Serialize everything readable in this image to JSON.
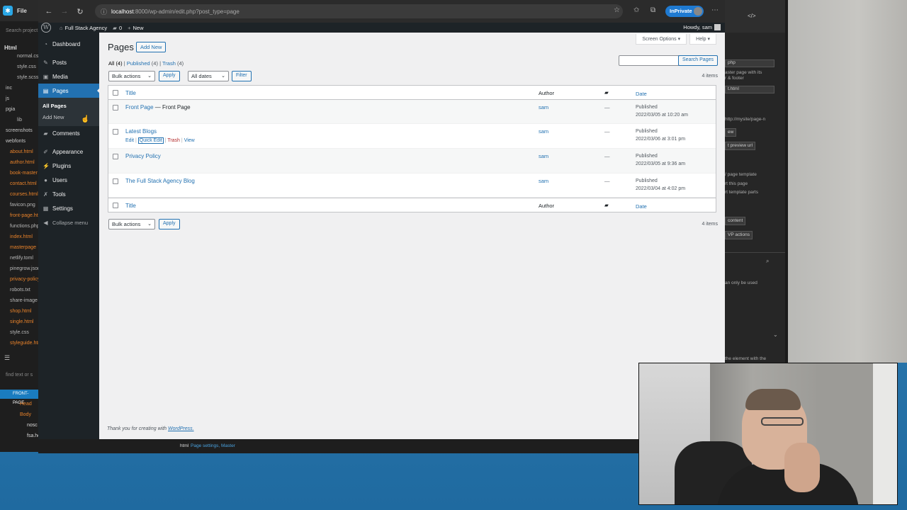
{
  "ide_left": {
    "top_label": "File",
    "search_placeholder": "Search project",
    "html_heading": "Html",
    "files": [
      {
        "name": "normal.css",
        "type": "indent-plain"
      },
      {
        "name": "style.css",
        "type": "indent-plain"
      },
      {
        "name": "style.scss",
        "type": "indent-plain"
      },
      {
        "name": "inc",
        "type": "folder"
      },
      {
        "name": "js",
        "type": "folder"
      },
      {
        "name": "pgia",
        "type": "folder"
      },
      {
        "name": "lib",
        "type": "indent-plain"
      },
      {
        "name": "screenshots",
        "type": "folder"
      },
      {
        "name": "webfonts",
        "type": "folder"
      },
      {
        "name": "about.html",
        "type": "orange"
      },
      {
        "name": "author.html",
        "type": "orange"
      },
      {
        "name": "book-master",
        "type": "orange"
      },
      {
        "name": "contact.html",
        "type": "orange"
      },
      {
        "name": "courses.html",
        "type": "orange"
      },
      {
        "name": "favicon.png",
        "type": "plain"
      },
      {
        "name": "front-page.html",
        "type": "orange"
      },
      {
        "name": "functions.php",
        "type": "plain"
      },
      {
        "name": "index.html",
        "type": "orange"
      },
      {
        "name": "masterpage",
        "type": "orange"
      },
      {
        "name": "netlify.toml",
        "type": "plain"
      },
      {
        "name": "pinegrow.json",
        "type": "plain"
      },
      {
        "name": "privacy-policy",
        "type": "orange"
      },
      {
        "name": "robots.txt",
        "type": "plain"
      },
      {
        "name": "share-image",
        "type": "plain"
      },
      {
        "name": "shop.html",
        "type": "orange"
      },
      {
        "name": "single.html",
        "type": "orange"
      },
      {
        "name": "style.css",
        "type": "plain"
      },
      {
        "name": "styleguide.html",
        "type": "orange"
      }
    ],
    "find_placeholder": "find text or s",
    "tree": {
      "selected": "FRONT-PAGE",
      "head": "Head",
      "body": "Body",
      "nosc": "nosc",
      "fsa": "fsa.head"
    }
  },
  "browser": {
    "url_host": "localhost",
    "url_path": ":8000/wp-admin/edit.php?post_type=page",
    "inprivate": "InPrivate"
  },
  "adminbar": {
    "site_name": "Full Stack Agency",
    "comments_count": "0",
    "new_label": "New",
    "howdy": "Howdy, sam"
  },
  "menu": {
    "dashboard": "Dashboard",
    "posts": "Posts",
    "media": "Media",
    "pages": "Pages",
    "all_pages": "All Pages",
    "add_new": "Add New",
    "comments": "Comments",
    "appearance": "Appearance",
    "plugins": "Plugins",
    "users": "Users",
    "tools": "Tools",
    "settings": "Settings",
    "collapse": "Collapse menu"
  },
  "content": {
    "screen_options": "Screen Options ▾",
    "help": "Help ▾",
    "title": "Pages",
    "add_new": "Add New",
    "filters": {
      "all": "All",
      "all_count": "(4)",
      "published": "Published",
      "published_count": "(4)",
      "trash": "Trash",
      "trash_count": "(4)",
      "sep": "|"
    },
    "search_button": "Search Pages",
    "bulk_actions": "Bulk actions",
    "apply": "Apply",
    "all_dates": "All dates",
    "filter": "Filter",
    "items_count": "4 items",
    "columns": {
      "title": "Title",
      "author": "Author",
      "date": "Date"
    },
    "rows": [
      {
        "title": "Front Page",
        "state": " — Front Page",
        "author": "sam",
        "comments": "—",
        "status": "Published",
        "date": "2022/03/05 at 10:20 am"
      },
      {
        "title": "Latest Blogs",
        "state": "",
        "author": "sam",
        "comments": "—",
        "status": "Published",
        "date": "2022/03/06 at 3:01 pm"
      },
      {
        "title": "Privacy Policy",
        "state": "",
        "author": "sam",
        "comments": "—",
        "status": "Published",
        "date": "2022/03/05 at 9:36 am"
      },
      {
        "title": "The Full Stack Agency Blog",
        "state": "",
        "author": "sam",
        "comments": "—",
        "status": "Published",
        "date": "2022/03/04 at 4:02 pm"
      }
    ],
    "row_actions": {
      "edit": "Edit",
      "quick_edit": "Quick Edit",
      "trash": "Trash",
      "view": "View",
      "sep": "|"
    },
    "footer_thanks": "Thank you for creating with ",
    "footer_link": "WordPress."
  },
  "ide_right": {
    "select1": "php",
    "desc1": "aster page with its",
    "desc2": "r & footer",
    "select2": "t.html",
    "url_hint": "http://mysite/page-n",
    "btn_view": "ew",
    "btn_preview": "t preview url",
    "text_page_template": "/ page template",
    "text_this_page": "rt this page",
    "text_template_parts": "rt template parts",
    "btn_content": "content",
    "btn_wp_actions": "VP actions",
    "text_only_used": "an only be used",
    "text_element": "the element with the"
  },
  "ide_status": {
    "tag": "html",
    "info": "Page settings, Master"
  },
  "colors": {
    "wp_dark": "#1d2327",
    "wp_blue": "#2271b1",
    "ide_orange": "#e8822a"
  }
}
